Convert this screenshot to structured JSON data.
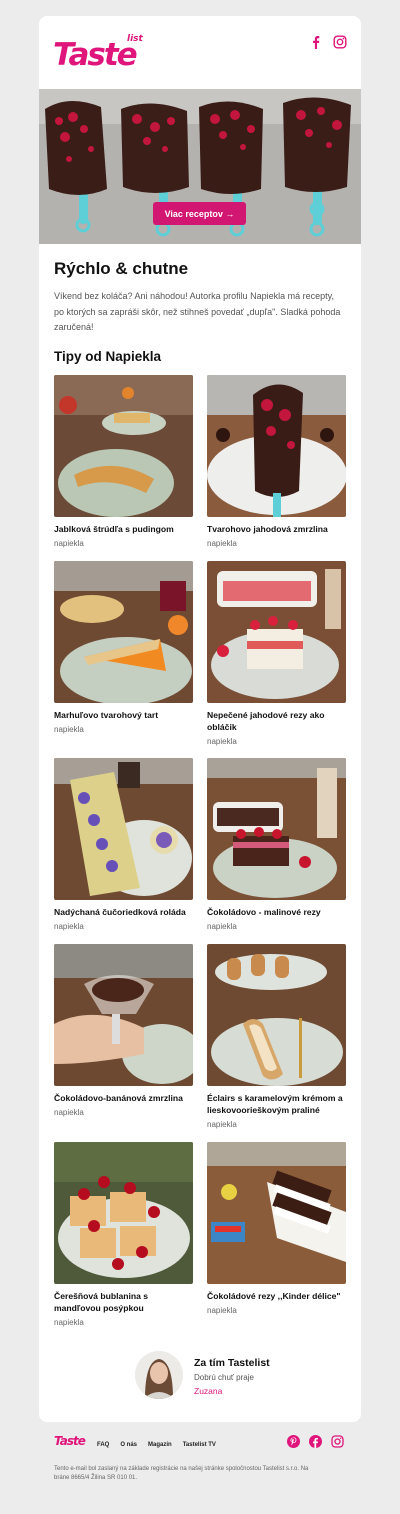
{
  "header": {
    "logo_text": "Taste",
    "logo_sub": "list",
    "social": [
      "facebook-icon",
      "instagram-icon"
    ]
  },
  "hero": {
    "button_label": "Viac receptov →"
  },
  "main": {
    "title": "Rýchlo & chutne",
    "intro": "Víkend bez koláča? Ani náhodou! Autorka profilu Napiekla má recepty, po ktorých sa zapráši skôr, než stihneš povedať „dupľa\". Sladká pohoda zaručená!",
    "section_title": "Tipy od Napiekla"
  },
  "recipes": [
    {
      "title": "Jablková štrúdľa s pudingom",
      "author": "napiekla"
    },
    {
      "title": "Tvarohovo jahodová zmrzlina",
      "author": "napiekla"
    },
    {
      "title": "Marhuľovo tvarohový tart",
      "author": "napiekla"
    },
    {
      "title": "Nepečené jahodové rezy ako obláčik",
      "author": "napiekla"
    },
    {
      "title": "Nadýchaná čučoriedková roláda",
      "author": "napiekla"
    },
    {
      "title": "Čokoládovo - malinové rezy",
      "author": "napiekla"
    },
    {
      "title": "Čokoládovo-banánová zmrzlina",
      "author": "napiekla"
    },
    {
      "title": "Éclairs s karamelovým krémom a lieskovoorieškovým praliné",
      "author": "napiekla"
    },
    {
      "title": "Čerešňová bublanina s mandľovou posýpkou",
      "author": "napiekla"
    },
    {
      "title": "Čokoládové rezy ,,Kinder délice\"",
      "author": "napiekla"
    }
  ],
  "signature": {
    "title": "Za tím Tastelist",
    "subtitle": "Dobrú chuť praje",
    "name": "Zuzana"
  },
  "footer": {
    "logo_text": "Taste",
    "links": [
      "FAQ",
      "O nás",
      "Magazín",
      "Tastelist TV"
    ],
    "social": [
      "pinterest-icon",
      "facebook-icon",
      "instagram-icon"
    ],
    "legal": "Tento e-mail bol zaslaný na základe registrácie na našej stránke spoločnostou Tastelist s.r.o. Na bráne 8665/4 Žilina SR 010 01."
  },
  "colors": {
    "brand": "#e0157b",
    "button": "#d21773",
    "page_bg": "#ececec"
  }
}
